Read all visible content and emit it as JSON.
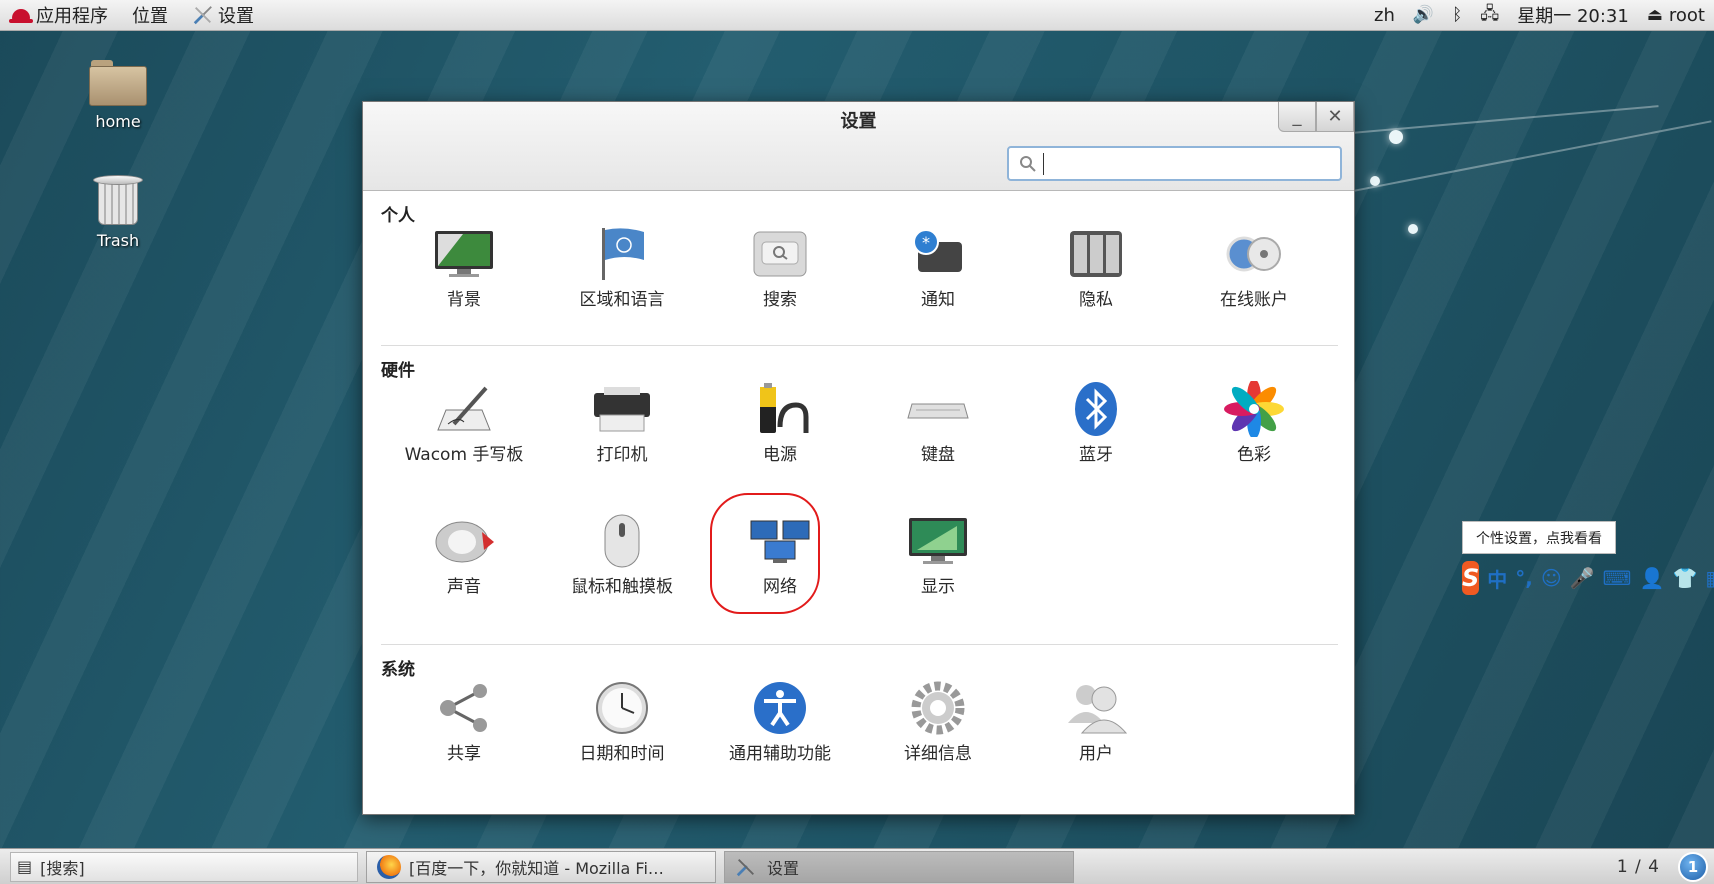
{
  "top_panel": {
    "applications": "应用程序",
    "places": "位置",
    "active_app": "设置",
    "lang": "zh",
    "clock": "星期一 20:31",
    "user": "root"
  },
  "desktop": {
    "home_label": "home",
    "trash_label": "Trash"
  },
  "window": {
    "title": "设置",
    "minimize": "_",
    "close": "✕",
    "search_placeholder": ""
  },
  "sections": {
    "personal": {
      "title": "个人",
      "items": [
        "背景",
        "区域和语言",
        "搜索",
        "通知",
        "隐私",
        "在线账户"
      ]
    },
    "hardware": {
      "title": "硬件",
      "items": [
        "Wacom 手写板",
        "打印机",
        "电源",
        "键盘",
        "蓝牙",
        "色彩",
        "声音",
        "鼠标和触摸板",
        "网络",
        "显示"
      ]
    },
    "system": {
      "title": "系统",
      "items": [
        "共享",
        "日期和时间",
        "通用辅助功能",
        "详细信息",
        "用户"
      ]
    }
  },
  "taskbar": {
    "search": "[搜索]",
    "task_firefox": "[百度一下，你就知道 - Mozilla Fi…",
    "task_settings": "设置",
    "pager": "1 / 4",
    "workspace": "1"
  },
  "ime": {
    "tooltip": "个性设置，点我看看",
    "logo": "S",
    "mode": "中",
    "punct": "°,"
  },
  "colors": {
    "highlight": "#e21b1b",
    "desktop": "#235d6f"
  }
}
